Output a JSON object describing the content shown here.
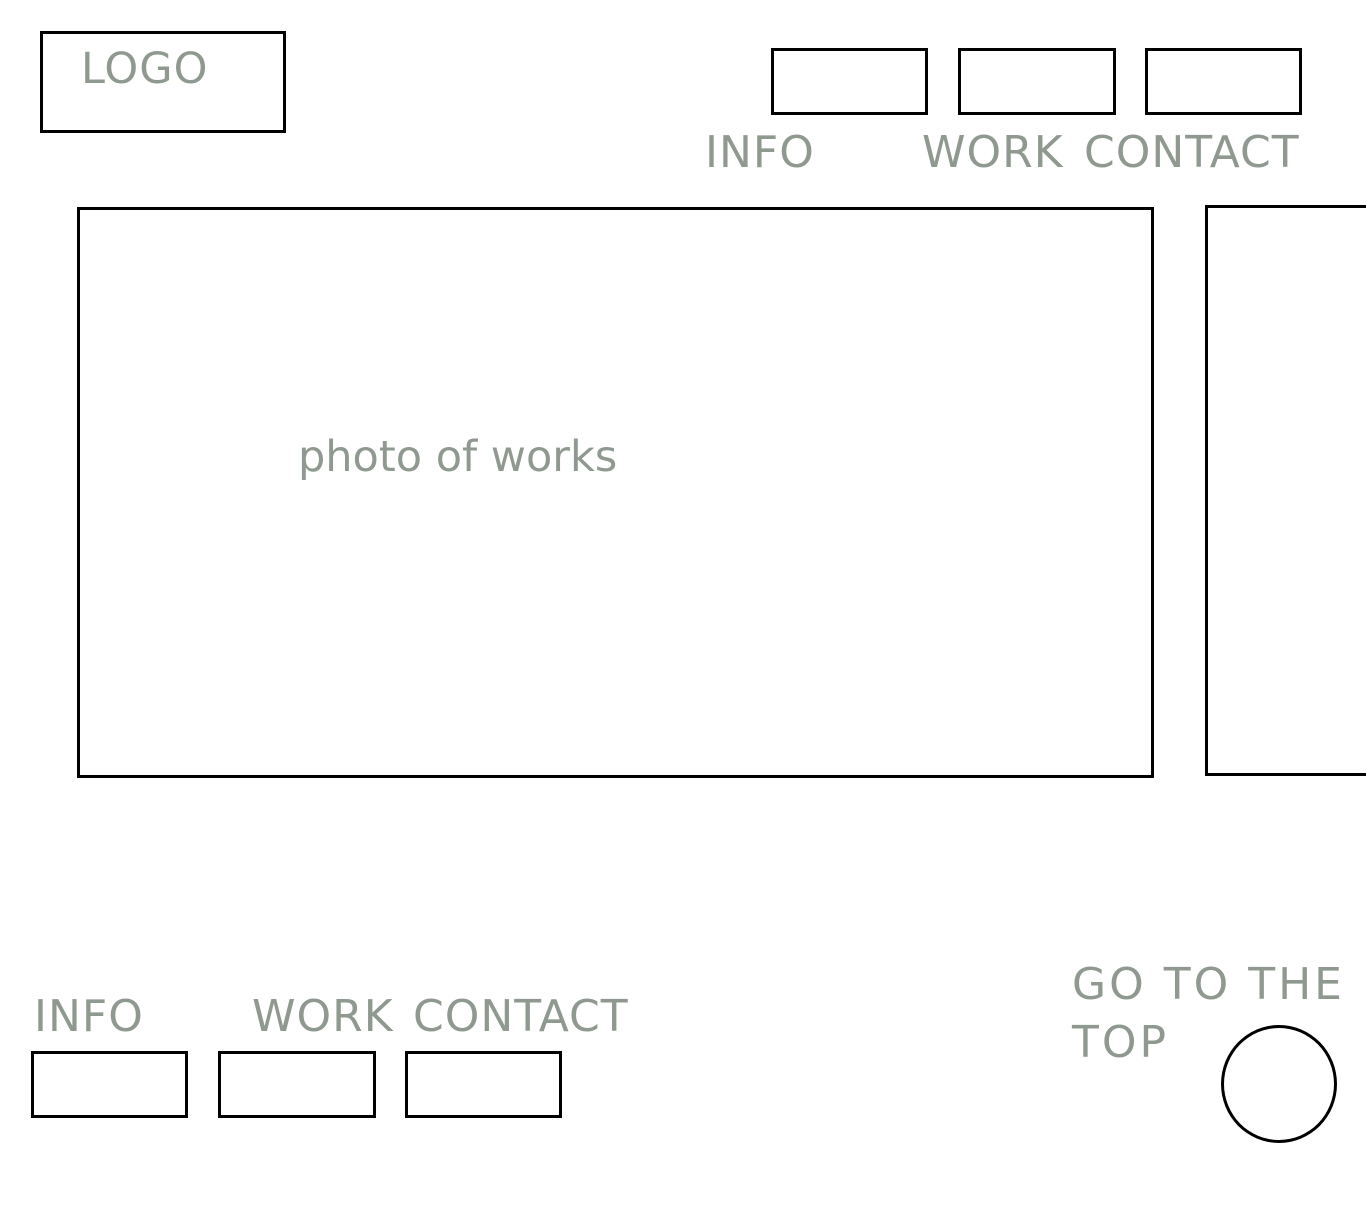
{
  "header": {
    "logo_label": "LOGO",
    "nav": {
      "info_label": "INFO",
      "work_label": "WORK",
      "contact_label": "CONTACT"
    }
  },
  "main": {
    "photo_label": "photo of works"
  },
  "footer": {
    "nav": {
      "info_label": "INFO",
      "work_label": "WORK",
      "contact_label": "CONTACT"
    },
    "go_top_label": "GO TO THE TOP"
  },
  "colors": {
    "text": "#8f9990",
    "border": "#000000",
    "background": "#ffffff"
  }
}
